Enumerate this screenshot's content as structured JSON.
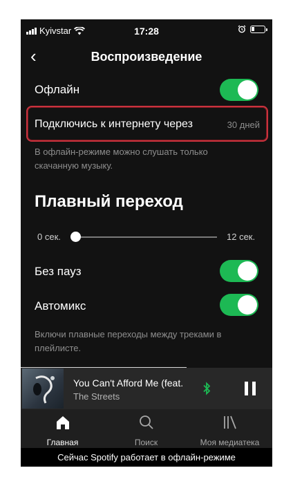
{
  "status": {
    "carrier": "Kyivstar",
    "time": "17:28"
  },
  "header": {
    "title": "Воспроизведение"
  },
  "settings": {
    "offline_label": "Офлайн",
    "reconnect_label": "Подключись к интернету через",
    "reconnect_value": "30 дней",
    "offline_hint": "В офлайн-режиме можно слушать только скачанную музыку.",
    "crossfade_title": "Плавный переход",
    "slider_min": "0 сек.",
    "slider_max": "12 сек.",
    "slider_value": 0,
    "gapless_label": "Без пауз",
    "automix_label": "Автомикс",
    "crossfade_hint": "Включи плавные переходы между треками в плейлисте.",
    "offline_on": true,
    "gapless_on": true,
    "automix_on": true
  },
  "now_playing": {
    "title": "You Can't Afford Me (feat.",
    "artist": "The Streets",
    "progress": 0.66
  },
  "nav": {
    "tabs": [
      {
        "label": "Главная",
        "icon": "home-icon"
      },
      {
        "label": "Поиск",
        "icon": "search-icon"
      },
      {
        "label": "Моя медиатека",
        "icon": "library-icon"
      }
    ]
  },
  "banner": {
    "text": "Сейчас Spotify работает в офлайн-режиме"
  },
  "colors": {
    "accent": "#1db954",
    "highlight": "#c8323d",
    "background": "#121212"
  }
}
